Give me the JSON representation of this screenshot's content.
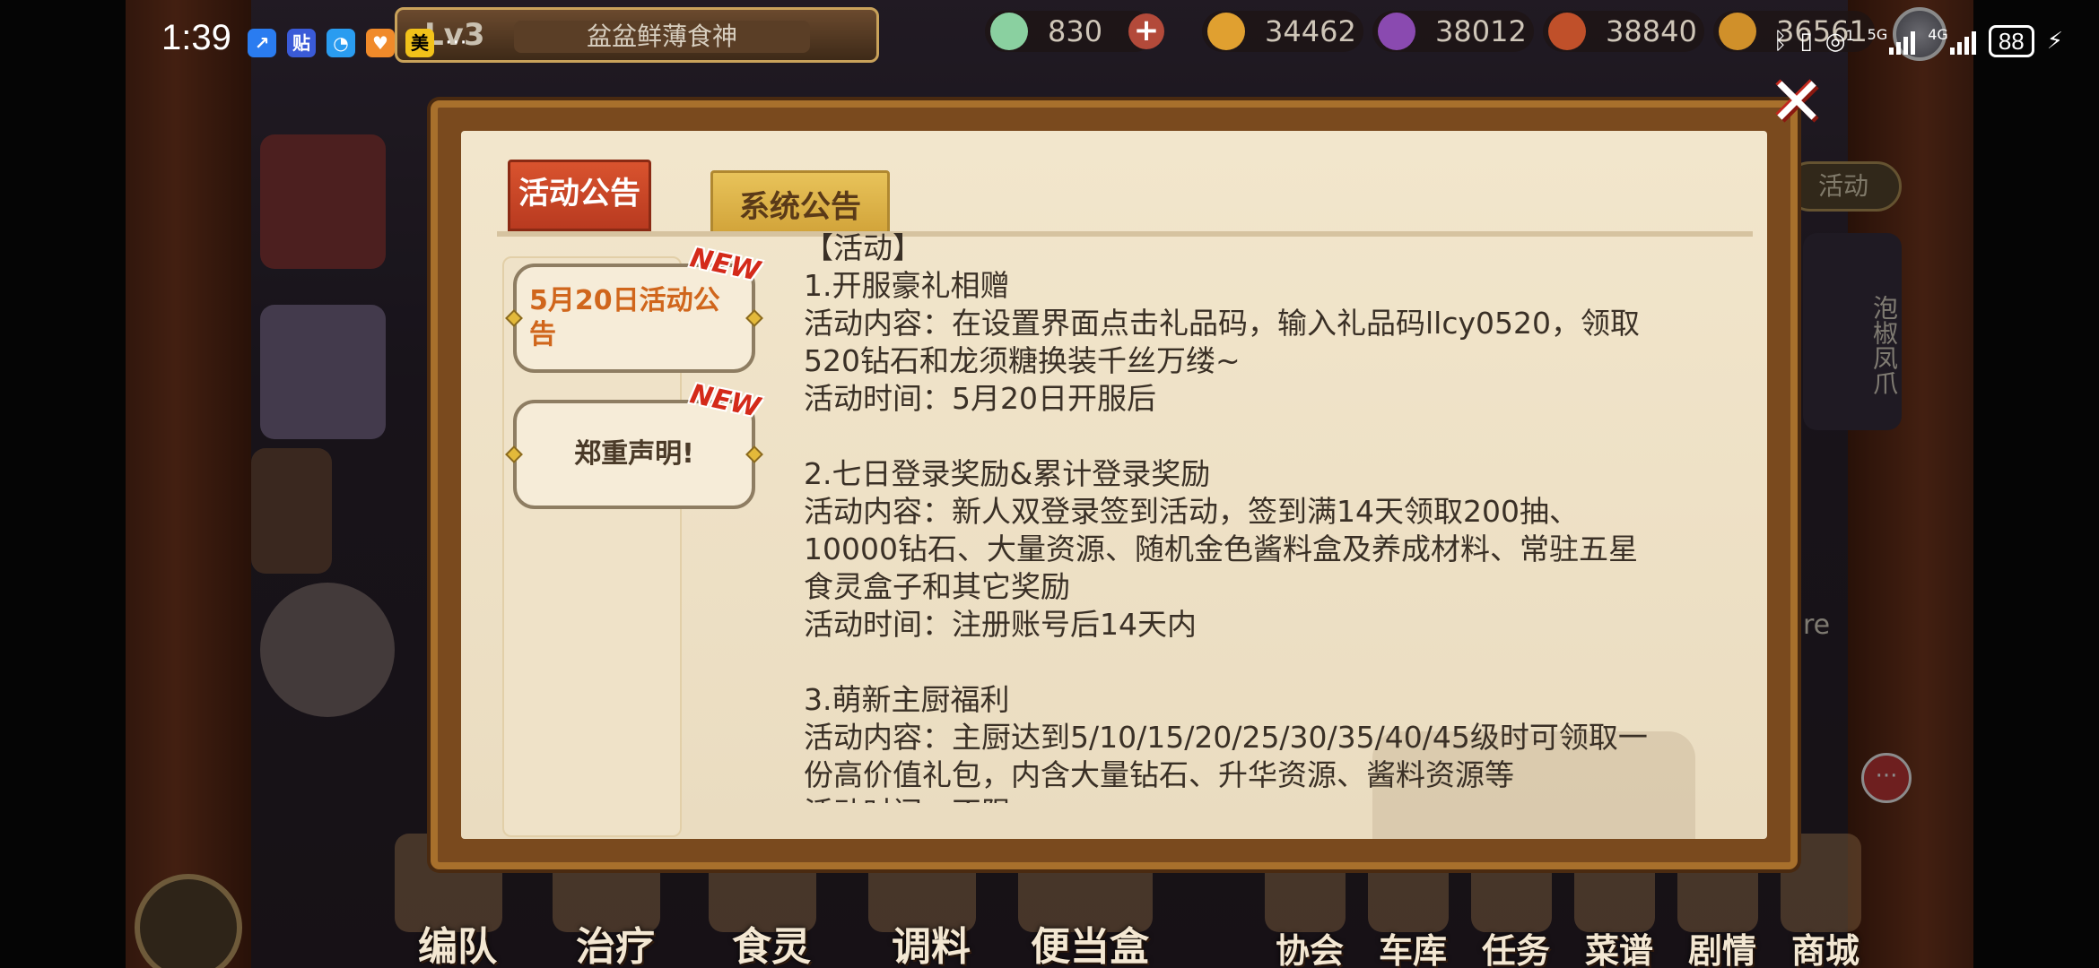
{
  "status_bar": {
    "time": "1:39",
    "app_icons": [
      {
        "name": "app1-icon",
        "glyph": "↗",
        "color": "#2a7cf0"
      },
      {
        "name": "app2-icon",
        "glyph": "贴",
        "color": "#3a5bd8"
      },
      {
        "name": "app3-icon",
        "glyph": "◔",
        "color": "#2a9cf0"
      },
      {
        "name": "app4-icon",
        "glyph": "♥",
        "color": "#f08a2a"
      },
      {
        "name": "app5-icon",
        "glyph": "美",
        "color": "#f2c21a"
      }
    ],
    "more": "···",
    "network_5g": "5G",
    "network_4g": "4G",
    "sim_sup": "1",
    "battery": "88"
  },
  "hud": {
    "level": "Lv3",
    "player_name": "盆盆鲜薄食神",
    "resources": [
      {
        "name": "diamond",
        "value": "830",
        "color": "#8ad0a0",
        "has_plus": true
      },
      {
        "name": "coin",
        "value": "34462",
        "color": "#e0a030",
        "has_plus": false
      },
      {
        "name": "gem",
        "value": "38012",
        "color": "#8a4ab0",
        "has_plus": false
      },
      {
        "name": "food",
        "value": "38840",
        "color": "#c0502a",
        "has_plus": false
      },
      {
        "name": "veg",
        "value": "36561",
        "color": "#d0902a",
        "has_plus": false
      }
    ]
  },
  "scene": {
    "activity_tag": "活动",
    "character_banner": "泡椒凤爪",
    "tag_fragment": "re"
  },
  "bottom_nav": {
    "items": [
      "编队",
      "治疗",
      "食灵",
      "调料",
      "便当盒",
      "协会",
      "车库",
      "任务",
      "菜谱",
      "剧情",
      "商城"
    ]
  },
  "dialog": {
    "close_glyph": "✕",
    "tabs": [
      {
        "label": "活动公告",
        "active": true
      },
      {
        "label": "系统公告",
        "active": false
      }
    ],
    "notices": [
      {
        "title": "5月20日活动公告",
        "badge": "NEW",
        "selected": true
      },
      {
        "title": "郑重声明!",
        "badge": "NEW",
        "selected": false
      }
    ],
    "content_lines": [
      "【活动】",
      "1.开服豪礼相赠",
      "活动内容：在设置界面点击礼品码，输入礼品码llcy0520，领取",
      "520钻石和龙须糖换装千丝万缕~",
      "活动时间：5月20日开服后",
      "",
      "2.七日登录奖励&累计登录奖励",
      "活动内容：新人双登录签到活动，签到满14天领取200抽、",
      "10000钻石、大量资源、随机金色酱料盒及养成材料、常驻五星",
      "食灵盒子和其它奖励",
      "活动时间：注册账号后14天内",
      "",
      "3.萌新主厨福利",
      "活动内容：主厨达到5/10/15/20/25/30/35/40/45级时可领取一",
      "份高价值礼包，内含大量钻石、升华资源、酱料资源等",
      "活动时间：不限"
    ]
  },
  "colors": {
    "tab_active": "#c8432a",
    "tab_inactive": "#ddb24a",
    "selected_notice_text": "#d0661c",
    "notice_text": "#4a3a28",
    "paper": "#efe3c8",
    "frame": "#a8702c"
  }
}
